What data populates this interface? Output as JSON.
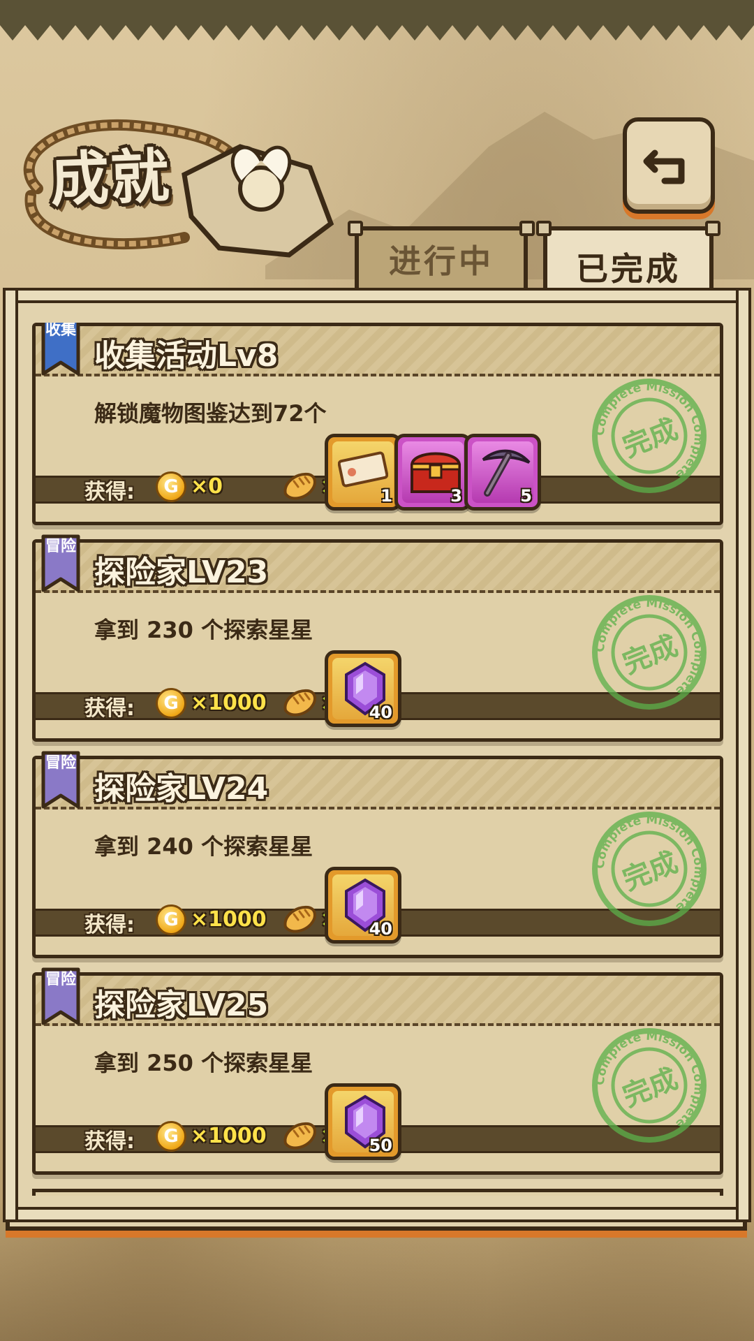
{
  "header": {
    "title": "成就"
  },
  "tabs": [
    {
      "label": "进行中",
      "active": false
    },
    {
      "label": "已完成",
      "active": true
    }
  ],
  "colors": {
    "outline": "#3b2a16",
    "accent_orange": "#d8782a",
    "coin_text": "#ffe24a",
    "bread_text": "#c9f33c",
    "stamp_green": "#5bb04a",
    "badge_blue": "#3f6fc6",
    "badge_purple": "#8a79c7"
  },
  "reward_label": "获得:",
  "stamp_label": "完成",
  "stamp_ring_text": "Complete Mission Complete",
  "coin_glyph": "G",
  "achievements": [
    {
      "badge": "收集",
      "badge_color": "#3f6fc6",
      "title": "收集活动Lv8",
      "desc": "解锁魔物图鉴达到72个",
      "coins": "×0",
      "bread": "×0",
      "items": [
        {
          "icon": "ticket-icon",
          "frame": "gold",
          "qty": "1"
        },
        {
          "icon": "treasure-chest-icon",
          "frame": "purple",
          "qty": "3"
        },
        {
          "icon": "pickaxe-icon",
          "frame": "purple",
          "qty": "5"
        }
      ]
    },
    {
      "badge": "冒险",
      "badge_color": "#8a79c7",
      "title": "探险家LV23",
      "desc": "拿到 230 个探索星星",
      "coins": "×1000",
      "bread": "×5",
      "items": [
        {
          "icon": "purple-gem-icon",
          "frame": "gold",
          "qty": "40"
        }
      ]
    },
    {
      "badge": "冒险",
      "badge_color": "#8a79c7",
      "title": "探险家LV24",
      "desc": "拿到 240 个探索星星",
      "coins": "×1000",
      "bread": "×5",
      "items": [
        {
          "icon": "purple-gem-icon",
          "frame": "gold",
          "qty": "40"
        }
      ]
    },
    {
      "badge": "冒险",
      "badge_color": "#8a79c7",
      "title": "探险家LV25",
      "desc": "拿到 250 个探索星星",
      "coins": "×1000",
      "bread": "×5",
      "items": [
        {
          "icon": "purple-gem-icon",
          "frame": "gold",
          "qty": "50"
        }
      ]
    }
  ]
}
